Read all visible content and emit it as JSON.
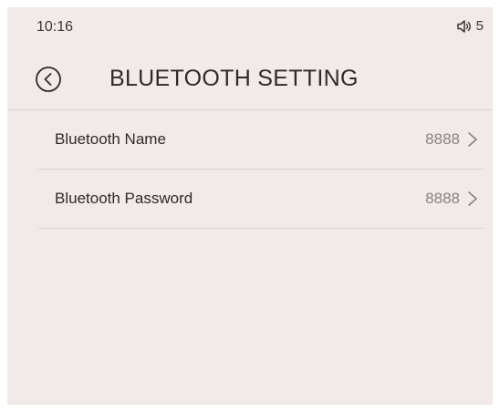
{
  "status_bar": {
    "time": "10:16",
    "volume_icon": "speaker-volume-icon",
    "volume_level": "5"
  },
  "header": {
    "back_icon": "back-arrow-circle-icon",
    "title": "BLUETOOTH SETTING"
  },
  "settings": {
    "items": [
      {
        "label": "Bluetooth Name",
        "value": "8888",
        "icon": "chevron-right-icon"
      },
      {
        "label": "Bluetooth Password",
        "value": "8888",
        "icon": "chevron-right-icon"
      }
    ]
  },
  "colors": {
    "background": "#f2e9e9",
    "text_primary": "#2f2a2a",
    "text_secondary": "#8a8080",
    "divider": "#ddd2d2"
  }
}
